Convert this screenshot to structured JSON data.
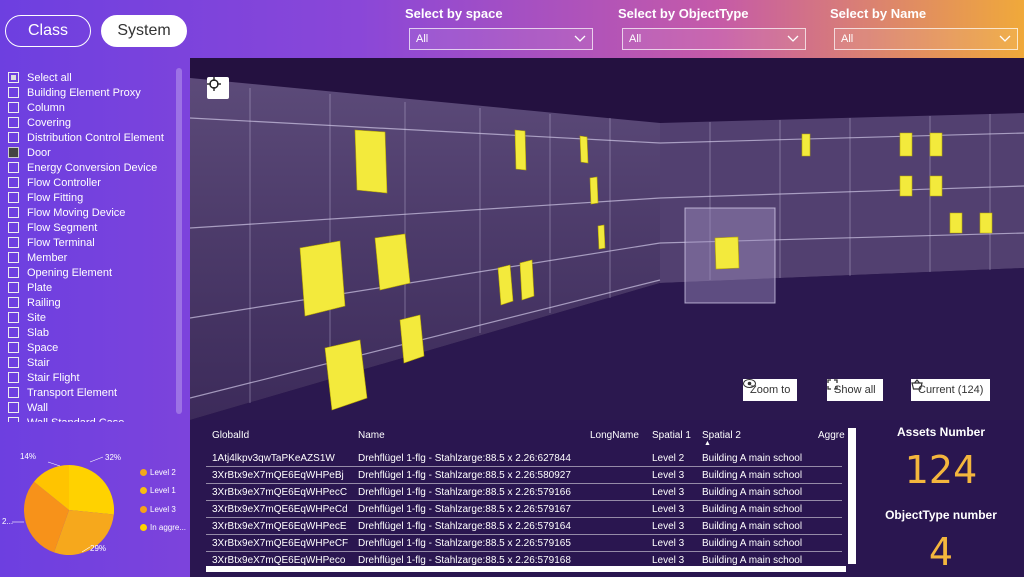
{
  "header": {
    "class_button": "Class",
    "system_button": "System",
    "filters": [
      {
        "label": "Select by space",
        "value": "All"
      },
      {
        "label": "Select by ObjectType",
        "value": "All"
      },
      {
        "label": "Select by Name",
        "value": "All"
      }
    ]
  },
  "sidebar": {
    "items": [
      {
        "label": "Select all",
        "state": "partial"
      },
      {
        "label": "Building Element Proxy",
        "state": "off"
      },
      {
        "label": "Column",
        "state": "off"
      },
      {
        "label": "Covering",
        "state": "off"
      },
      {
        "label": "Distribution Control Element",
        "state": "off"
      },
      {
        "label": "Door",
        "state": "checked"
      },
      {
        "label": "Energy Conversion Device",
        "state": "off"
      },
      {
        "label": "Flow Controller",
        "state": "off"
      },
      {
        "label": "Flow Fitting",
        "state": "off"
      },
      {
        "label": "Flow Moving Device",
        "state": "off"
      },
      {
        "label": "Flow Segment",
        "state": "off"
      },
      {
        "label": "Flow Terminal",
        "state": "off"
      },
      {
        "label": "Member",
        "state": "off"
      },
      {
        "label": "Opening Element",
        "state": "off"
      },
      {
        "label": "Plate",
        "state": "off"
      },
      {
        "label": "Railing",
        "state": "off"
      },
      {
        "label": "Site",
        "state": "off"
      },
      {
        "label": "Slab",
        "state": "off"
      },
      {
        "label": "Space",
        "state": "off"
      },
      {
        "label": "Stair",
        "state": "off"
      },
      {
        "label": "Stair Flight",
        "state": "off"
      },
      {
        "label": "Transport Element",
        "state": "off"
      },
      {
        "label": "Wall",
        "state": "off"
      },
      {
        "label": "Wall Standard Case",
        "state": "off"
      }
    ]
  },
  "pie": {
    "labels": {
      "top_left": "14%",
      "top_right": "32%",
      "left": "2...",
      "bottom": "29%"
    },
    "legend": [
      {
        "label": "Level 2",
        "color": "#f2a81c"
      },
      {
        "label": "Level 1",
        "color": "#f7be12"
      },
      {
        "label": "Level 3",
        "color": "#f6a01a"
      },
      {
        "label": "In aggre...",
        "color": "#ffd200"
      }
    ]
  },
  "viewport": {
    "zoom_to": "Zoom to",
    "show_all": "Show all",
    "current": "Current (124)"
  },
  "table": {
    "columns": [
      "GlobalId",
      "Name",
      "LongName",
      "Spatial 1",
      "Spatial 2",
      "Aggre"
    ],
    "rows": [
      [
        "1Atj4lkpv3qwTaPKeAZS1W",
        "Drehflügel 1-flg - Stahlzarge:88.5 x 2.26:627844",
        "",
        "Level 2",
        "Building A main school"
      ],
      [
        "3XrBtx9eX7mQE6EqWHPeBj",
        "Drehflügel 1-flg - Stahlzarge:88.5 x 2.26:580927",
        "",
        "Level 3",
        "Building A main school"
      ],
      [
        "3XrBtx9eX7mQE6EqWHPecC",
        "Drehflügel 1-flg - Stahlzarge:88.5 x 2.26:579166",
        "",
        "Level 3",
        "Building A main school"
      ],
      [
        "3XrBtx9eX7mQE6EqWHPeCd",
        "Drehflügel 1-flg - Stahlzarge:88.5 x 2.26:579167",
        "",
        "Level 3",
        "Building A main school"
      ],
      [
        "3XrBtx9eX7mQE6EqWHPecE",
        "Drehflügel 1-flg - Stahlzarge:88.5 x 2.26:579164",
        "",
        "Level 3",
        "Building A main school"
      ],
      [
        "3XrBtx9eX7mQE6EqWHPeCF",
        "Drehflügel 1-flg - Stahlzarge:88.5 x 2.26:579165",
        "",
        "Level 3",
        "Building A main school"
      ],
      [
        "3XrBtx9eX7mQE6EqWHPeco",
        "Drehflügel 1-flg - Stahlzarge:88.5 x 2.26:579168",
        "",
        "Level 3",
        "Building A main school"
      ]
    ]
  },
  "kpis": {
    "assets_label": "Assets Number",
    "assets_value": "124",
    "objecttype_label": "ObjectType number",
    "objecttype_value": "4"
  },
  "colors": {
    "accent_yellow": "#f4b63d",
    "panel_dark": "#2a1650",
    "viewport_bg": "#241140"
  }
}
